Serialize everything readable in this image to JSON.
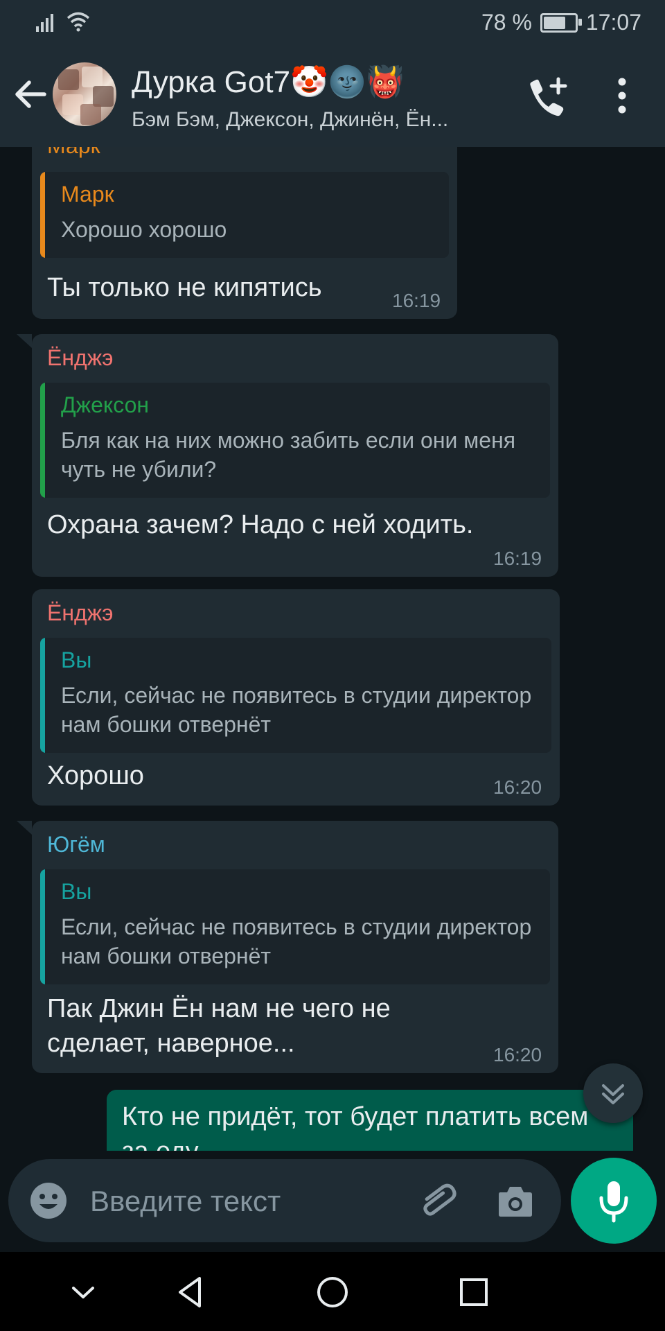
{
  "status_bar": {
    "battery": "78 %",
    "battery_level": 0.78,
    "time": "17:07"
  },
  "header": {
    "title": "Дурка Got7🤡🌚👹",
    "subtitle": "Бэм Бэм, Джексон, Джинён, Ён..."
  },
  "messages": [
    {
      "sender": "Марк",
      "quote_name": "Марк",
      "quote_text": "Хорошо хорошо",
      "text": "Ты только не кипятись",
      "time": "16:19"
    },
    {
      "sender": "Ёнджэ",
      "quote_name": "Джексон",
      "quote_text": "Бля как на них можно забить если они меня чуть не убили?",
      "text": "Охрана зачем? Надо с ней ходить.",
      "time": "16:19"
    },
    {
      "sender": "Ёнджэ",
      "quote_name": "Вы",
      "quote_text": "Если, сейчас не появитесь в студии директор нам бошки отвернёт",
      "text": "Хорошо",
      "time": "16:20"
    },
    {
      "sender": "Югём",
      "quote_name": "Вы",
      "quote_text": "Если, сейчас не появитесь в студии директор нам бошки отвернёт",
      "text": "Пак Джин Ён нам не чего не сделает,  наверное...",
      "time": "16:20"
    }
  ],
  "outgoing": {
    "text": "Кто не придёт, тот будет платить всем за еду"
  },
  "input": {
    "placeholder": "Введите текст"
  },
  "colors": {
    "mark": "#e8891c",
    "youngjae": "#f0736f",
    "jackson": "#22a04a",
    "you": "#16a3a0",
    "yugyeom": "#4fb8d8",
    "accent": "#00a884",
    "outgoing_bg": "#005c4b"
  },
  "icons": {
    "back": "arrow-left-icon",
    "add_call": "phone-plus-icon",
    "menu": "more-vertical-icon",
    "scroll_down": "double-chevron-down-icon",
    "emoji": "emoji-icon",
    "attach": "paperclip-icon",
    "camera": "camera-icon",
    "mic": "microphone-icon"
  }
}
